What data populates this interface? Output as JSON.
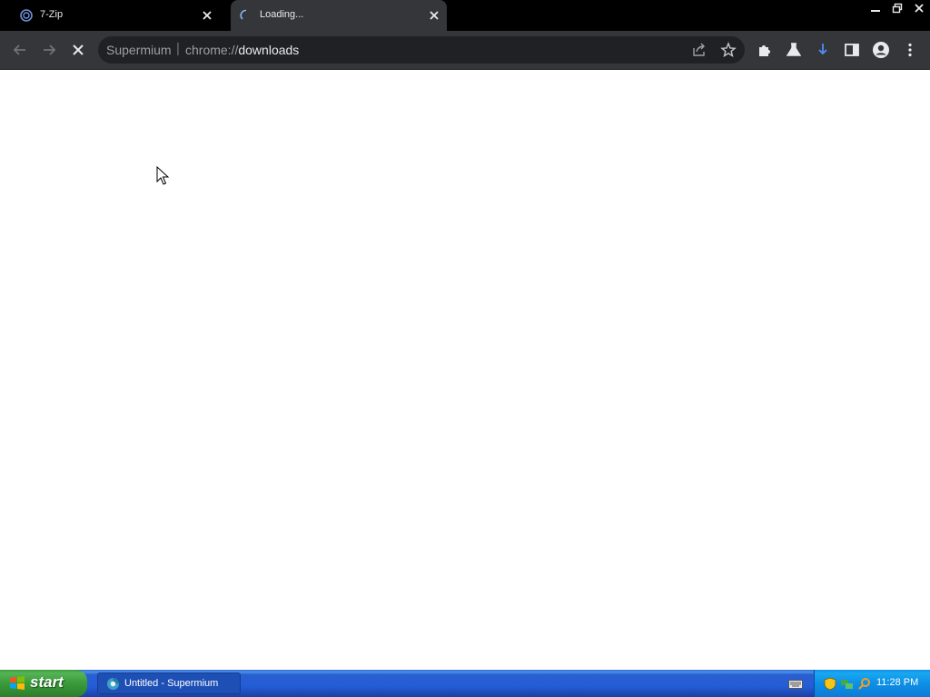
{
  "browser": {
    "tabs": [
      {
        "title": "7-Zip",
        "active": false
      },
      {
        "title": "Loading...",
        "active": true
      }
    ],
    "omnibox": {
      "site_name": "Supermium",
      "separator": "|",
      "url_scheme": "chrome://",
      "url_path": "downloads"
    },
    "toolbar_icons": [
      "back-icon",
      "forward-icon",
      "stop-icon",
      "share-icon",
      "bookmark-star-icon",
      "extensions-icon",
      "labs-icon",
      "downloads-icon",
      "side-panel-icon",
      "profile-icon",
      "menu-icon"
    ]
  },
  "window_controls": [
    "minimize-icon",
    "restore-icon",
    "close-icon"
  ],
  "taskbar": {
    "start_label": "start",
    "items": [
      {
        "label": "Untitled - Supermium"
      }
    ],
    "clock": "11:28 PM"
  },
  "colors": {
    "tab_strip": "#000000",
    "toolbar": "#35363a",
    "omnibox": "#202124",
    "taskbar": "#245dd7",
    "start_button": "#3a9a3a",
    "tray": "#0e8fe6"
  }
}
